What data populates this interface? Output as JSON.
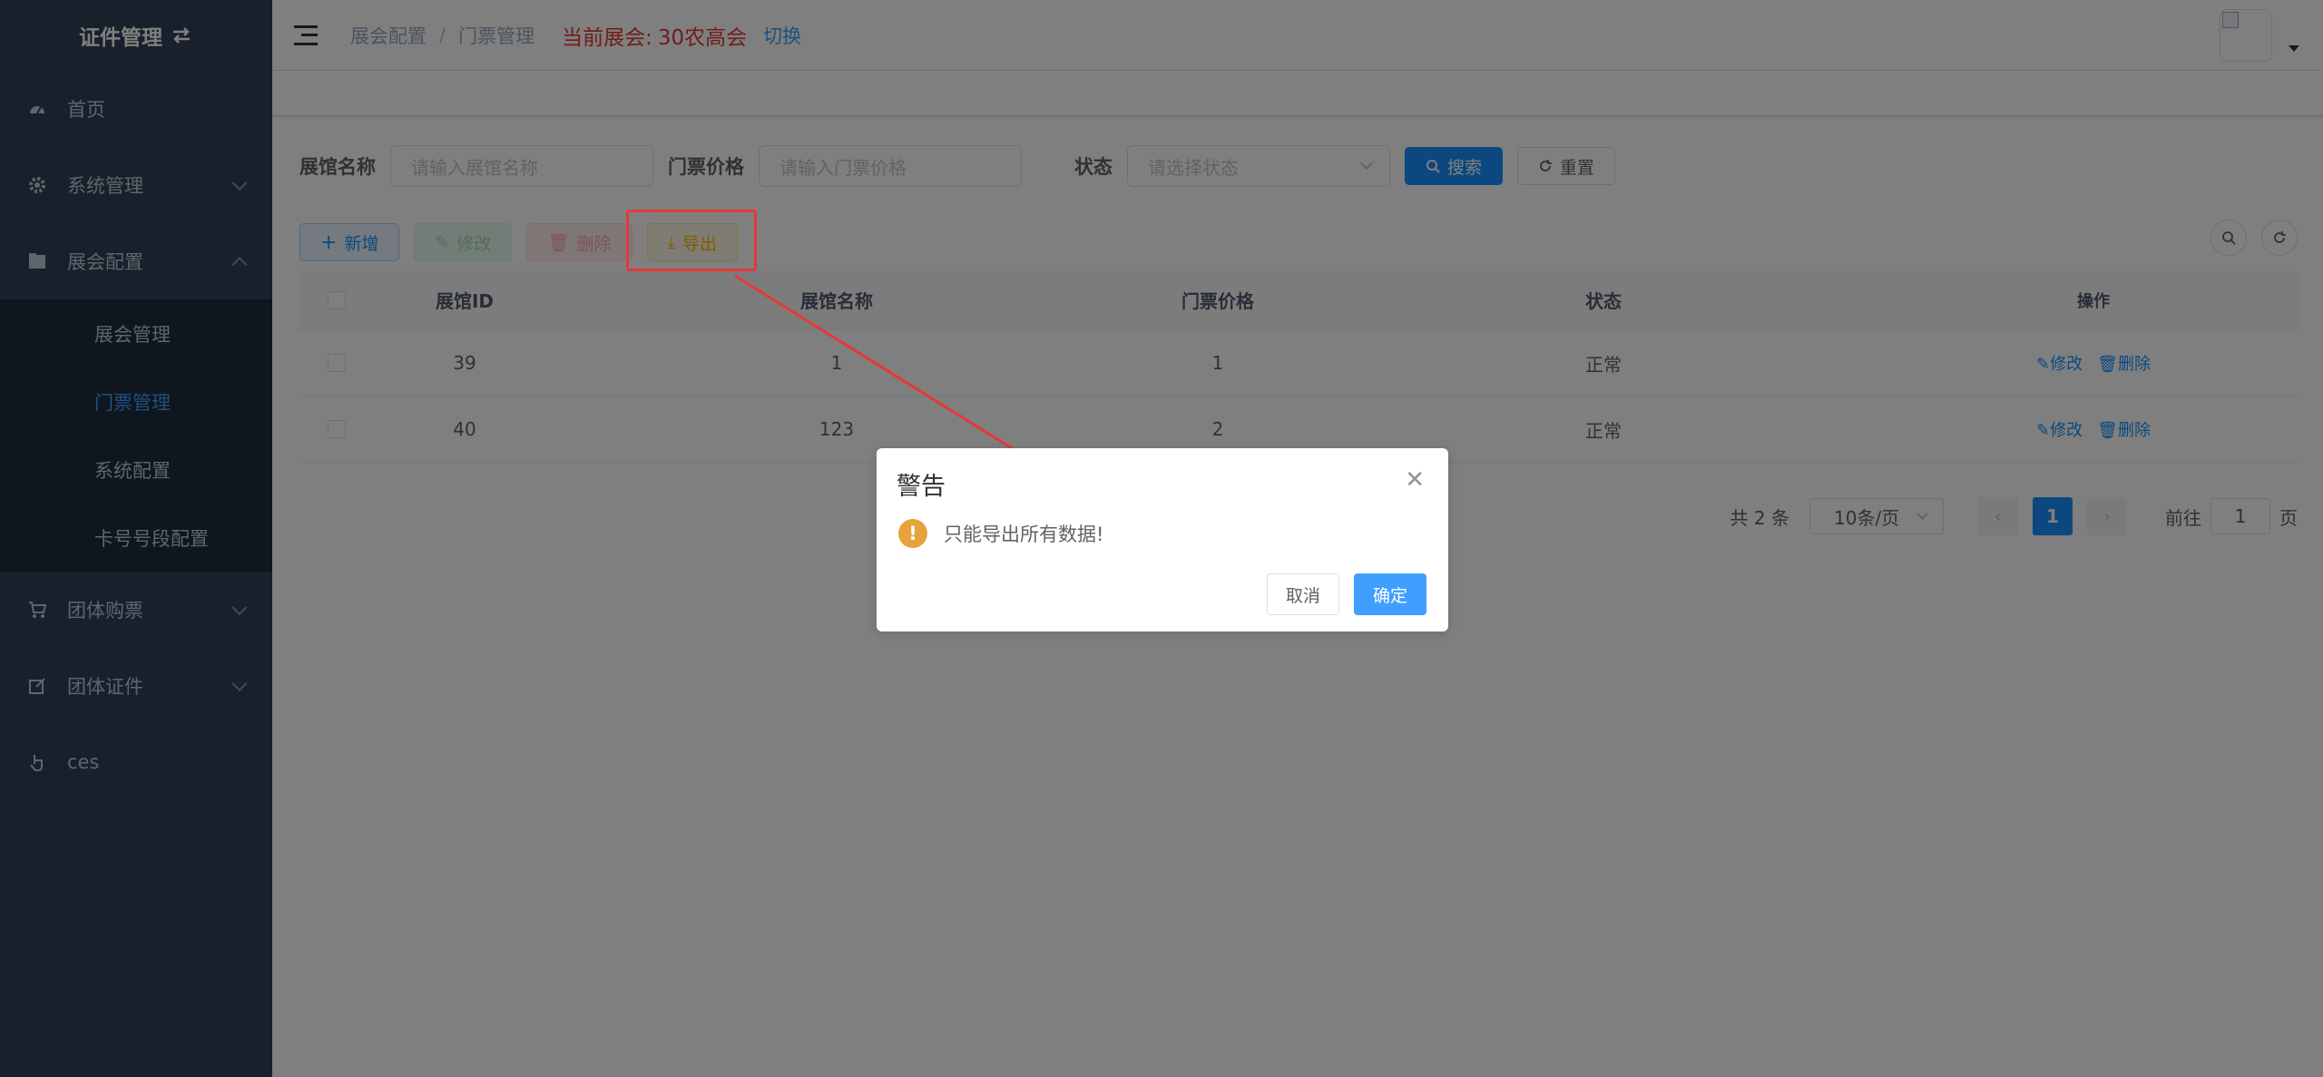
{
  "sidebar": {
    "logo_text": "证件管理",
    "items": [
      {
        "label": "首页",
        "icon": "dashboard-icon"
      },
      {
        "label": "系统管理",
        "icon": "gear-icon"
      },
      {
        "label": "展会配置",
        "icon": "folder-icon"
      },
      {
        "label": "团体购票",
        "icon": "cart-icon"
      },
      {
        "label": "团体证件",
        "icon": "edit-icon"
      },
      {
        "label": "ces",
        "icon": "pointer-icon"
      }
    ],
    "submenu": [
      {
        "label": "展会管理"
      },
      {
        "label": "门票管理"
      },
      {
        "label": "系统配置"
      },
      {
        "label": "卡号号段配置"
      }
    ]
  },
  "header": {
    "breadcrumb": [
      "展会配置",
      "门票管理"
    ],
    "breadcrumb_sep": "/",
    "expo_label": "当前展会:",
    "expo_name": "30农高会",
    "switch_label": "切换"
  },
  "search": {
    "hall_name_label": "展馆名称",
    "hall_name_placeholder": "请输入展馆名称",
    "price_label": "门票价格",
    "price_placeholder": "请输入门票价格",
    "status_label": "状态",
    "status_placeholder": "请选择状态",
    "search_button": "搜索",
    "reset_button": "重置"
  },
  "toolbar": {
    "add": "新增",
    "edit": "修改",
    "delete": "删除",
    "export": "导出"
  },
  "table": {
    "columns": [
      "展馆ID",
      "展馆名称",
      "门票价格",
      "状态",
      "操作"
    ],
    "rows": [
      {
        "id": "39",
        "name": "1",
        "price": "1",
        "status": "正常"
      },
      {
        "id": "40",
        "name": "123",
        "price": "2",
        "status": "正常"
      }
    ],
    "op_edit": "修改",
    "op_delete": "删除"
  },
  "pagination": {
    "total": "共 2 条",
    "page_size": "10条/页",
    "current_page": "1",
    "jump_prefix": "前往",
    "jump_value": "1",
    "jump_suffix": "页"
  },
  "dialog": {
    "title": "警告",
    "message": "只能导出所有数据!",
    "cancel": "取消",
    "confirm": "确定"
  },
  "colors": {
    "sidebar_bg": "#304156",
    "primary": "#1890ff",
    "annotation_red": "#e53935"
  }
}
